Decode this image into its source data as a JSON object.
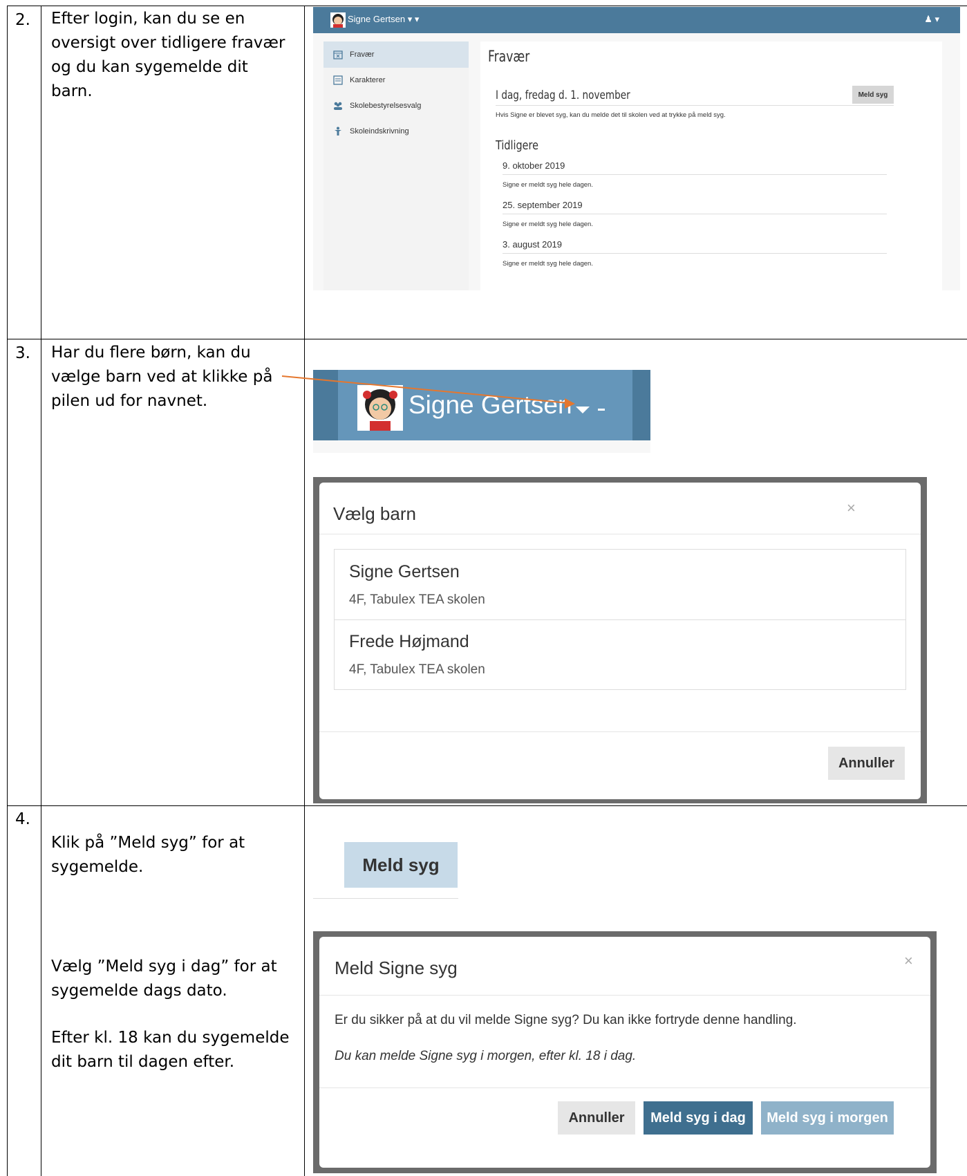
{
  "rows": [
    {
      "num": "2.",
      "text": "Efter login, kan du se en\noversigt over tidligere fravær\nog du kan sygemelde dit\nbarn."
    },
    {
      "num": "3.",
      "text": "Har du flere børn, kan du\nvælge barn ved at klikke på\npilen ud for navnet."
    },
    {
      "num": "4.",
      "text1": "Klik på ”Meld syg” for at\nsygemelde.",
      "text2": "Vælg ”Meld syg i dag” for at\nsygemelde dags dato.",
      "text3": "Efter kl. 18 kan du sygemelde\ndit barn til dagen efter."
    }
  ],
  "shot1": {
    "user_name": "Signe  Gertsen ▾ ▾",
    "user_menu": "▾",
    "nav": [
      "Fravær",
      "Karakterer",
      "Skolebestyrelsesvalg",
      "Skoleindskrivning"
    ],
    "title": "Fravær",
    "today_heading": "I dag, fredag d. 1. november",
    "meld_syg": "Meld syg",
    "today_note": "Hvis Signe er blevet syg, kan du melde det til skolen ved at trykke på meld syg.",
    "earlier_heading": "Tidligere",
    "entries": [
      {
        "date": "9. oktober 2019",
        "note": "Signe er meldt syg hele dagen."
      },
      {
        "date": "25. september 2019",
        "note": "Signe er meldt syg hele dagen."
      },
      {
        "date": "3. august 2019",
        "note": "Signe er meldt syg hele dagen."
      }
    ]
  },
  "shot2": {
    "name_big": "Signe  Gertsen",
    "modal_title": "Vælg barn",
    "close": "×",
    "children": [
      {
        "name": "Signe Gertsen",
        "school": "4F, Tabulex TEA skolen"
      },
      {
        "name": "Frede Højmand",
        "school": "4F, Tabulex TEA skolen"
      }
    ],
    "cancel": "Annuller"
  },
  "shot3": {
    "meld_syg_big": "Meld syg",
    "modal_title": "Meld Signe syg",
    "close": "×",
    "body": "Er du sikker på at du vil melde Signe syg? Du kan ikke fortryde denne handling.",
    "body_italic": "Du kan melde Signe syg i morgen, efter kl. 18 i dag.",
    "cancel": "Annuller",
    "today": "Meld syg i dag",
    "tomorrow": "Meld syg i morgen"
  },
  "colors": {
    "topbar": "#4b7a9b",
    "primary_button": "#3f6f8f",
    "arrow": "#e5772e"
  }
}
